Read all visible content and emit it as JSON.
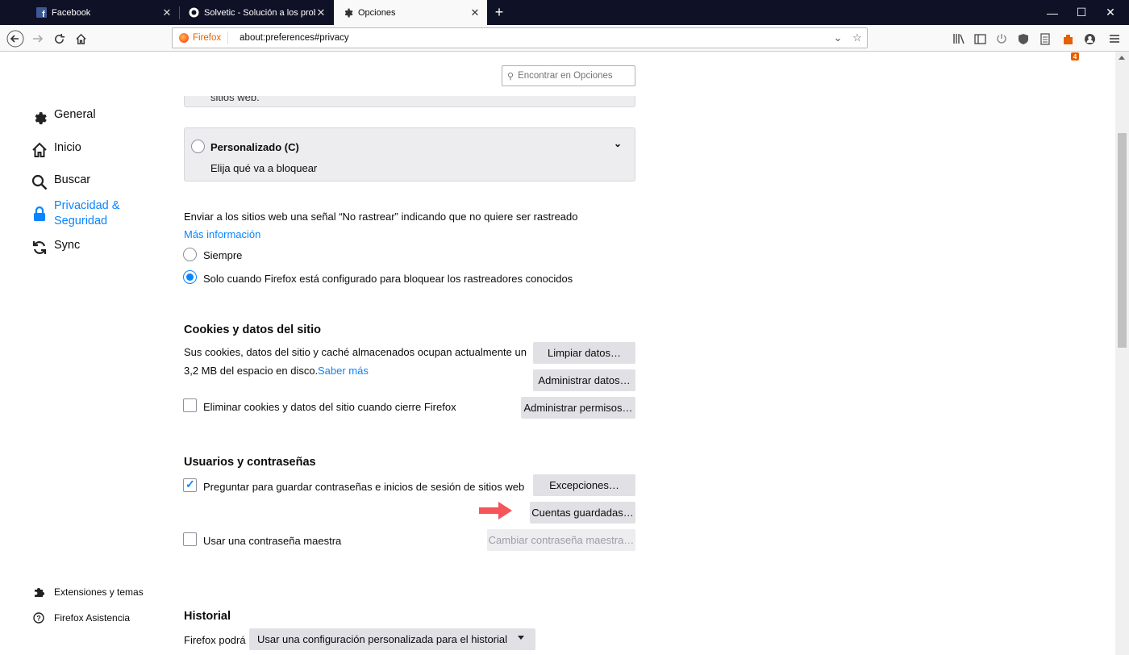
{
  "tabs": [
    {
      "label": "Facebook",
      "icon": "facebook-icon"
    },
    {
      "label": "Solvetic - Solución a los proble",
      "icon": "solvetic-icon"
    },
    {
      "label": "Opciones",
      "icon": "gear-icon"
    }
  ],
  "urlbar": {
    "identity_label": "Firefox",
    "url": "about:preferences#privacy"
  },
  "toolbar": {
    "notification_count": "4"
  },
  "search": {
    "placeholder": "Encontrar en Opciones"
  },
  "sidebar": {
    "items": [
      {
        "label": "General",
        "icon": "gear-icon"
      },
      {
        "label": "Inicio",
        "icon": "home-icon"
      },
      {
        "label": "Buscar",
        "icon": "search-icon"
      },
      {
        "label": "Privacidad &\nSeguridad",
        "icon": "lock-icon",
        "selected": true
      },
      {
        "label": "Sync",
        "icon": "sync-icon"
      }
    ],
    "footer": [
      {
        "label": "Extensiones y temas",
        "icon": "puzzle-icon"
      },
      {
        "label": "Firefox Asistencia",
        "icon": "help-icon"
      }
    ]
  },
  "tracking": {
    "prev_card_text": "sitios web.",
    "custom_title": "Personalizado (C)",
    "custom_desc": "Elija qué va a bloquear",
    "dnt_text": "Enviar a los sitios web una señal “No rastrear” indicando que no quiere ser rastreado",
    "more_info": "Más información",
    "always": "Siempre",
    "only_when": "Solo cuando Firefox está configurado para bloquear los rastreadores conocidos"
  },
  "cookies": {
    "title": "Cookies y datos del sitio",
    "desc_line1": "Sus cookies, datos del sitio y caché almacenados ocupan actualmente un",
    "desc_line2": "3,2 MB del espacio en disco.",
    "learn_more": "Saber más",
    "clear_button": "Limpiar datos…",
    "manage_button": "Administrar datos…",
    "permissions_button": "Administrar permisos…",
    "delete_on_close": "Eliminar cookies y datos del sitio cuando cierre Firefox"
  },
  "logins": {
    "title": "Usuarios y contraseñas",
    "ask_save": "Preguntar para guardar contraseñas e inicios de sesión de sitios web",
    "exceptions_button": "Excepciones…",
    "saved_button": "Cuentas guardadas…",
    "master_password": "Usar una contraseña maestra",
    "change_master_button": "Cambiar contraseña maestra…"
  },
  "history": {
    "title": "Historial",
    "will_label": "Firefox podrá",
    "mode": "Usar una configuración personalizada para el historial"
  },
  "colors": {
    "accent": "#0a84ff",
    "titlebar": "#0f1126",
    "arrow": "#f5545b"
  }
}
